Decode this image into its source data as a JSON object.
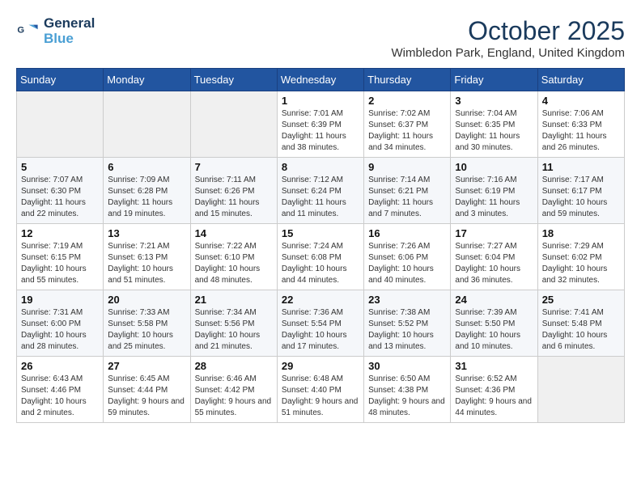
{
  "logo": {
    "line1": "General",
    "line2": "Blue"
  },
  "title": "October 2025",
  "subtitle": "Wimbledon Park, England, United Kingdom",
  "days_of_week": [
    "Sunday",
    "Monday",
    "Tuesday",
    "Wednesday",
    "Thursday",
    "Friday",
    "Saturday"
  ],
  "weeks": [
    [
      {
        "day": "",
        "text": ""
      },
      {
        "day": "",
        "text": ""
      },
      {
        "day": "",
        "text": ""
      },
      {
        "day": "1",
        "text": "Sunrise: 7:01 AM\nSunset: 6:39 PM\nDaylight: 11 hours and 38 minutes."
      },
      {
        "day": "2",
        "text": "Sunrise: 7:02 AM\nSunset: 6:37 PM\nDaylight: 11 hours and 34 minutes."
      },
      {
        "day": "3",
        "text": "Sunrise: 7:04 AM\nSunset: 6:35 PM\nDaylight: 11 hours and 30 minutes."
      },
      {
        "day": "4",
        "text": "Sunrise: 7:06 AM\nSunset: 6:33 PM\nDaylight: 11 hours and 26 minutes."
      }
    ],
    [
      {
        "day": "5",
        "text": "Sunrise: 7:07 AM\nSunset: 6:30 PM\nDaylight: 11 hours and 22 minutes."
      },
      {
        "day": "6",
        "text": "Sunrise: 7:09 AM\nSunset: 6:28 PM\nDaylight: 11 hours and 19 minutes."
      },
      {
        "day": "7",
        "text": "Sunrise: 7:11 AM\nSunset: 6:26 PM\nDaylight: 11 hours and 15 minutes."
      },
      {
        "day": "8",
        "text": "Sunrise: 7:12 AM\nSunset: 6:24 PM\nDaylight: 11 hours and 11 minutes."
      },
      {
        "day": "9",
        "text": "Sunrise: 7:14 AM\nSunset: 6:21 PM\nDaylight: 11 hours and 7 minutes."
      },
      {
        "day": "10",
        "text": "Sunrise: 7:16 AM\nSunset: 6:19 PM\nDaylight: 11 hours and 3 minutes."
      },
      {
        "day": "11",
        "text": "Sunrise: 7:17 AM\nSunset: 6:17 PM\nDaylight: 10 hours and 59 minutes."
      }
    ],
    [
      {
        "day": "12",
        "text": "Sunrise: 7:19 AM\nSunset: 6:15 PM\nDaylight: 10 hours and 55 minutes."
      },
      {
        "day": "13",
        "text": "Sunrise: 7:21 AM\nSunset: 6:13 PM\nDaylight: 10 hours and 51 minutes."
      },
      {
        "day": "14",
        "text": "Sunrise: 7:22 AM\nSunset: 6:10 PM\nDaylight: 10 hours and 48 minutes."
      },
      {
        "day": "15",
        "text": "Sunrise: 7:24 AM\nSunset: 6:08 PM\nDaylight: 10 hours and 44 minutes."
      },
      {
        "day": "16",
        "text": "Sunrise: 7:26 AM\nSunset: 6:06 PM\nDaylight: 10 hours and 40 minutes."
      },
      {
        "day": "17",
        "text": "Sunrise: 7:27 AM\nSunset: 6:04 PM\nDaylight: 10 hours and 36 minutes."
      },
      {
        "day": "18",
        "text": "Sunrise: 7:29 AM\nSunset: 6:02 PM\nDaylight: 10 hours and 32 minutes."
      }
    ],
    [
      {
        "day": "19",
        "text": "Sunrise: 7:31 AM\nSunset: 6:00 PM\nDaylight: 10 hours and 28 minutes."
      },
      {
        "day": "20",
        "text": "Sunrise: 7:33 AM\nSunset: 5:58 PM\nDaylight: 10 hours and 25 minutes."
      },
      {
        "day": "21",
        "text": "Sunrise: 7:34 AM\nSunset: 5:56 PM\nDaylight: 10 hours and 21 minutes."
      },
      {
        "day": "22",
        "text": "Sunrise: 7:36 AM\nSunset: 5:54 PM\nDaylight: 10 hours and 17 minutes."
      },
      {
        "day": "23",
        "text": "Sunrise: 7:38 AM\nSunset: 5:52 PM\nDaylight: 10 hours and 13 minutes."
      },
      {
        "day": "24",
        "text": "Sunrise: 7:39 AM\nSunset: 5:50 PM\nDaylight: 10 hours and 10 minutes."
      },
      {
        "day": "25",
        "text": "Sunrise: 7:41 AM\nSunset: 5:48 PM\nDaylight: 10 hours and 6 minutes."
      }
    ],
    [
      {
        "day": "26",
        "text": "Sunrise: 6:43 AM\nSunset: 4:46 PM\nDaylight: 10 hours and 2 minutes."
      },
      {
        "day": "27",
        "text": "Sunrise: 6:45 AM\nSunset: 4:44 PM\nDaylight: 9 hours and 59 minutes."
      },
      {
        "day": "28",
        "text": "Sunrise: 6:46 AM\nSunset: 4:42 PM\nDaylight: 9 hours and 55 minutes."
      },
      {
        "day": "29",
        "text": "Sunrise: 6:48 AM\nSunset: 4:40 PM\nDaylight: 9 hours and 51 minutes."
      },
      {
        "day": "30",
        "text": "Sunrise: 6:50 AM\nSunset: 4:38 PM\nDaylight: 9 hours and 48 minutes."
      },
      {
        "day": "31",
        "text": "Sunrise: 6:52 AM\nSunset: 4:36 PM\nDaylight: 9 hours and 44 minutes."
      },
      {
        "day": "",
        "text": ""
      }
    ]
  ]
}
